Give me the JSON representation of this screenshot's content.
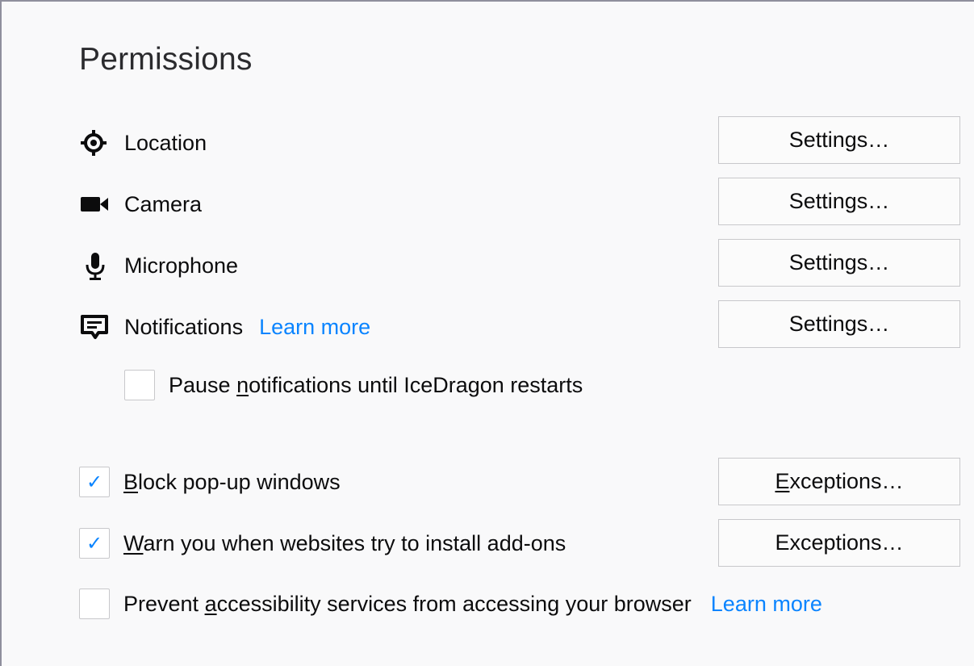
{
  "section": {
    "title": "Permissions"
  },
  "permissions": [
    {
      "icon": "location-icon",
      "label": "Location",
      "button": "Settings…"
    },
    {
      "icon": "camera-icon",
      "label": "Camera",
      "button": "Settings…"
    },
    {
      "icon": "microphone-icon",
      "label": "Microphone",
      "button": "Settings…"
    },
    {
      "icon": "notifications-icon",
      "label": "Notifications",
      "link": "Learn more",
      "button": "Settings…"
    }
  ],
  "pause_notifications": {
    "checked": false,
    "label_pre": "Pause ",
    "label_accel": "n",
    "label_post": "otifications until IceDragon restarts"
  },
  "block_popups": {
    "checked": true,
    "label_accel": "B",
    "label_post": "lock pop-up windows",
    "button_accel": "E",
    "button_post": "xceptions…"
  },
  "warn_addons": {
    "checked": true,
    "label_accel": "W",
    "label_post": "arn you when websites try to install add-ons",
    "button": "Exceptions…"
  },
  "prevent_accessibility": {
    "checked": false,
    "label_pre": "Prevent ",
    "label_accel": "a",
    "label_post": "ccessibility services from accessing your browser",
    "link": "Learn more"
  },
  "colors": {
    "link": "#0a84ff",
    "checkmark": "#0a84ff",
    "background": "#f9f9fa"
  }
}
